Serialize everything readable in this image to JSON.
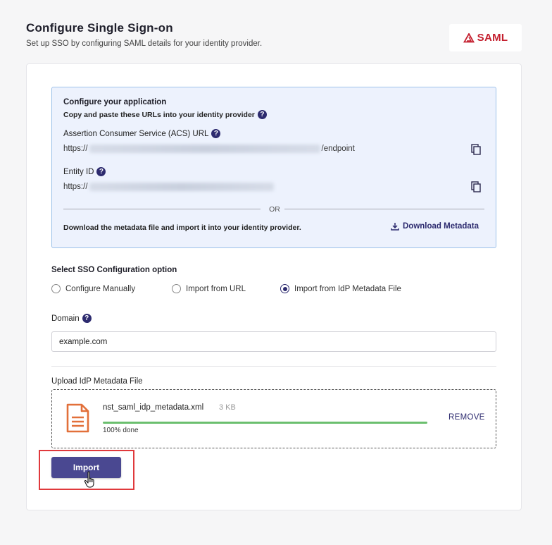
{
  "header": {
    "title": "Configure Single Sign-on",
    "subtitle": "Set up SSO by configuring SAML details for your identity provider.",
    "badge_text": "SAML"
  },
  "app_config": {
    "heading": "Configure your application",
    "instruction": "Copy and paste these URLs into your identity provider",
    "acs_label": "Assertion Consumer Service (ACS) URL",
    "acs_prefix": "https://",
    "acs_suffix": "/endpoint",
    "entity_label": "Entity ID",
    "entity_prefix": "https://",
    "or_text": "OR",
    "download_text": "Download the metadata file and import it into your identity provider.",
    "download_link": "Download Metadata"
  },
  "sso_option": {
    "label": "Select SSO Configuration option",
    "options": [
      "Configure Manually",
      "Import from URL",
      "Import from IdP Metadata File"
    ],
    "selected": "Import from IdP Metadata File"
  },
  "domain": {
    "label": "Domain",
    "value": "example.com"
  },
  "upload": {
    "label": "Upload IdP Metadata File",
    "file_name": "nst_saml_idp_metadata.xml",
    "file_size": "3 KB",
    "progress_percent": 100,
    "progress_text": "100% done",
    "remove_label": "REMOVE"
  },
  "actions": {
    "import_label": "Import"
  },
  "colors": {
    "accent": "#2d2b6f",
    "button": "#4a4891",
    "progress": "#6bbf6e",
    "highlight": "#e0393c",
    "file_icon": "#e2703a",
    "saml_brand": "#c41f2e",
    "info_bg": "#edf2fd"
  },
  "icons": {
    "help": "question-circle-icon",
    "copy": "copy-icon",
    "download": "download-icon",
    "file": "file-document-icon",
    "logo": "saml-logo-icon",
    "cursor": "hand-pointer-icon"
  }
}
